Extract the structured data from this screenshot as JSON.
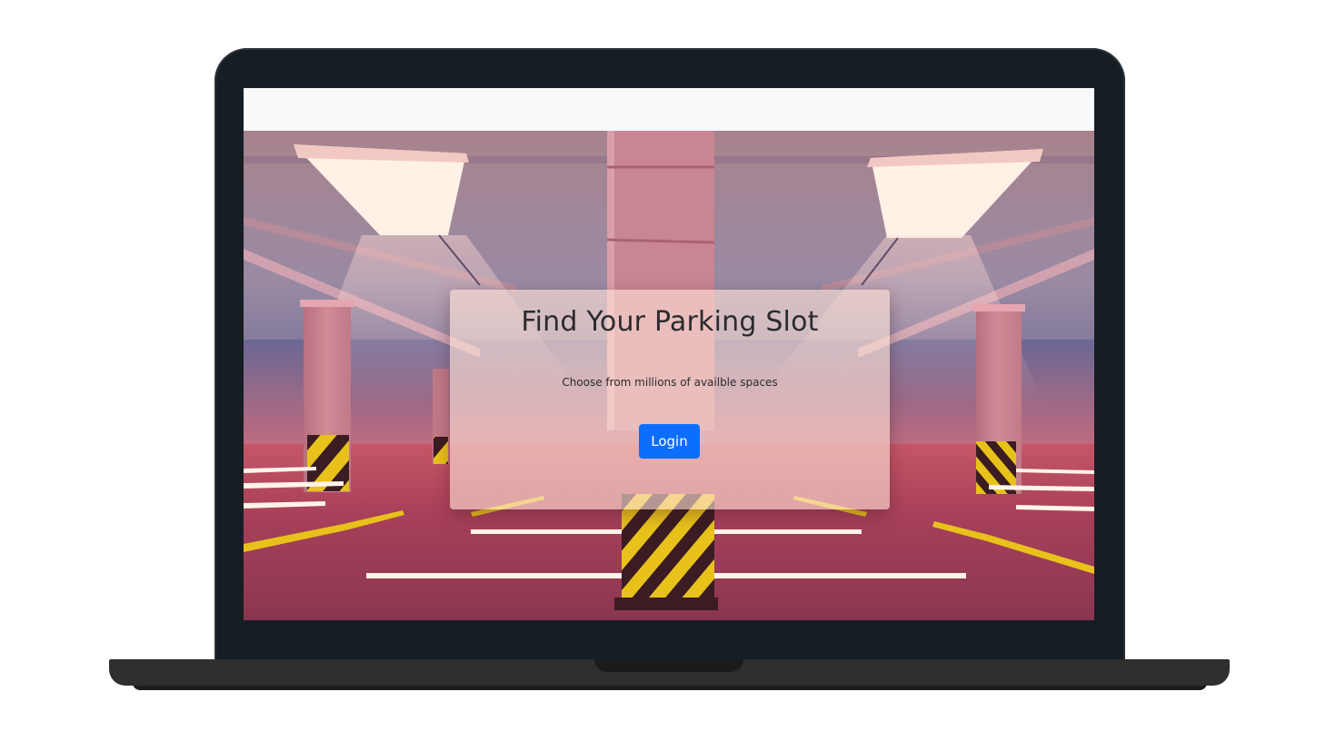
{
  "hero": {
    "title": "Find Your Parking Slot",
    "subtitle": "Choose from millions of availble spaces",
    "login_label": "Login"
  },
  "colors": {
    "primary_button": "#0d6efd",
    "laptop_bezel": "#161d23",
    "laptop_base": "#2f2f2f",
    "navbar": "#f8f9fa",
    "floor": "#a43d55",
    "hazard_yellow": "#e8c21a"
  },
  "background_scene": "parking-garage-illustration"
}
